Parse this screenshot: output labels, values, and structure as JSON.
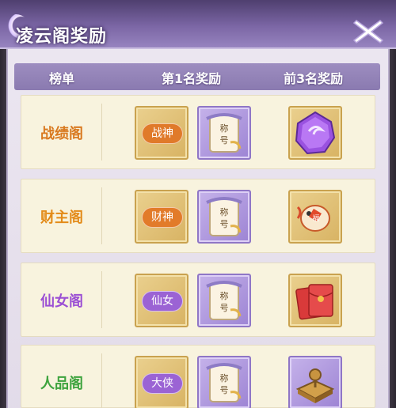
{
  "window": {
    "title": "凌云阁奖励"
  },
  "table": {
    "headers": [
      "榜单",
      "第1名奖励",
      "前3名奖励"
    ]
  },
  "rows": [
    {
      "label": "战绩阁",
      "label_color": "#d9791f",
      "badge_text": "战神",
      "badge_color": "#e07a2a",
      "title_scroll": "称号",
      "reward_icon": "purple-gem-icon"
    },
    {
      "label": "财主阁",
      "label_color": "#e38b19",
      "badge_text": "财神",
      "badge_color": "#e27b2a",
      "title_scroll": "称号",
      "reward_icon": "fortune-fish-icon"
    },
    {
      "label": "仙女阁",
      "label_color": "#9b4fd4",
      "badge_text": "仙女",
      "badge_color": "#9b63d4",
      "title_scroll": "称号",
      "reward_icon": "red-envelope-icon"
    },
    {
      "label": "人品阁",
      "label_color": "#3da33d",
      "badge_text": "大侠",
      "badge_color": "#9b63d4",
      "title_scroll": "称号",
      "reward_icon": "stone-tablet-icon"
    }
  ]
}
